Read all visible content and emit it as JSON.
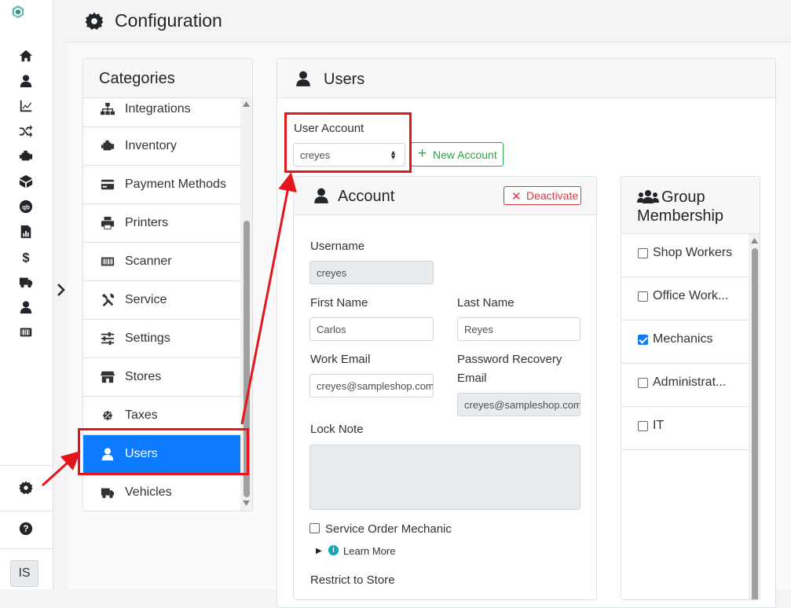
{
  "header": {
    "title": "Configuration"
  },
  "categories": {
    "title": "Categories",
    "items": [
      {
        "label": "Integrations",
        "icon": "sitemap-icon"
      },
      {
        "label": "Inventory",
        "icon": "engine-icon"
      },
      {
        "label": "Payment Methods",
        "icon": "credit-card-icon"
      },
      {
        "label": "Printers",
        "icon": "printer-icon"
      },
      {
        "label": "Scanner",
        "icon": "barcode-icon"
      },
      {
        "label": "Service",
        "icon": "tools-icon"
      },
      {
        "label": "Settings",
        "icon": "sliders-icon"
      },
      {
        "label": "Stores",
        "icon": "store-icon"
      },
      {
        "label": "Taxes",
        "icon": "percent-icon"
      },
      {
        "label": "Users",
        "icon": "user-icon",
        "active": true
      },
      {
        "label": "Vehicles",
        "icon": "truck-icon"
      }
    ]
  },
  "users": {
    "title": "Users",
    "user_account_label": "User Account",
    "user_account_value": "creyes",
    "new_account_label": "New Account"
  },
  "account": {
    "title": "Account",
    "deactivate_label": "Deactivate",
    "username_label": "Username",
    "username_value": "creyes",
    "first_name_label": "First Name",
    "first_name_value": "Carlos",
    "last_name_label": "Last Name",
    "last_name_value": "Reyes",
    "work_email_label": "Work Email",
    "work_email_value": "creyes@sampleshop.com",
    "recovery_email_label_1": "Password Recovery",
    "recovery_email_label_2": "Email",
    "recovery_email_value": "creyes@sampleshop.com",
    "lock_note_label": "Lock Note",
    "service_order_mechanic_label": "Service Order Mechanic",
    "learn_more_label": "Learn More",
    "restrict_label": "Restrict to Store"
  },
  "group": {
    "title_line1": "Group",
    "title_line2": "Membership",
    "items": [
      {
        "label": "Shop Workers",
        "checked": false
      },
      {
        "label": "Office Work...",
        "checked": false
      },
      {
        "label": "Mechanics",
        "checked": true
      },
      {
        "label": "Administrat...",
        "checked": false
      },
      {
        "label": "IT",
        "checked": false
      }
    ]
  },
  "rail": {
    "avatar_initials": "IS",
    "nav_icons": [
      "home-icon",
      "user-icon",
      "chart-line-icon",
      "shuffle-icon",
      "engine-icon",
      "box-icon",
      "quickbooks-icon",
      "report-icon",
      "dollar-icon",
      "truck-icon",
      "user-icon",
      "barcode-icon"
    ]
  },
  "colors": {
    "accent": "#0d7bff",
    "danger": "#dc3545",
    "success": "#28a745",
    "annotation": "#e3161d"
  }
}
